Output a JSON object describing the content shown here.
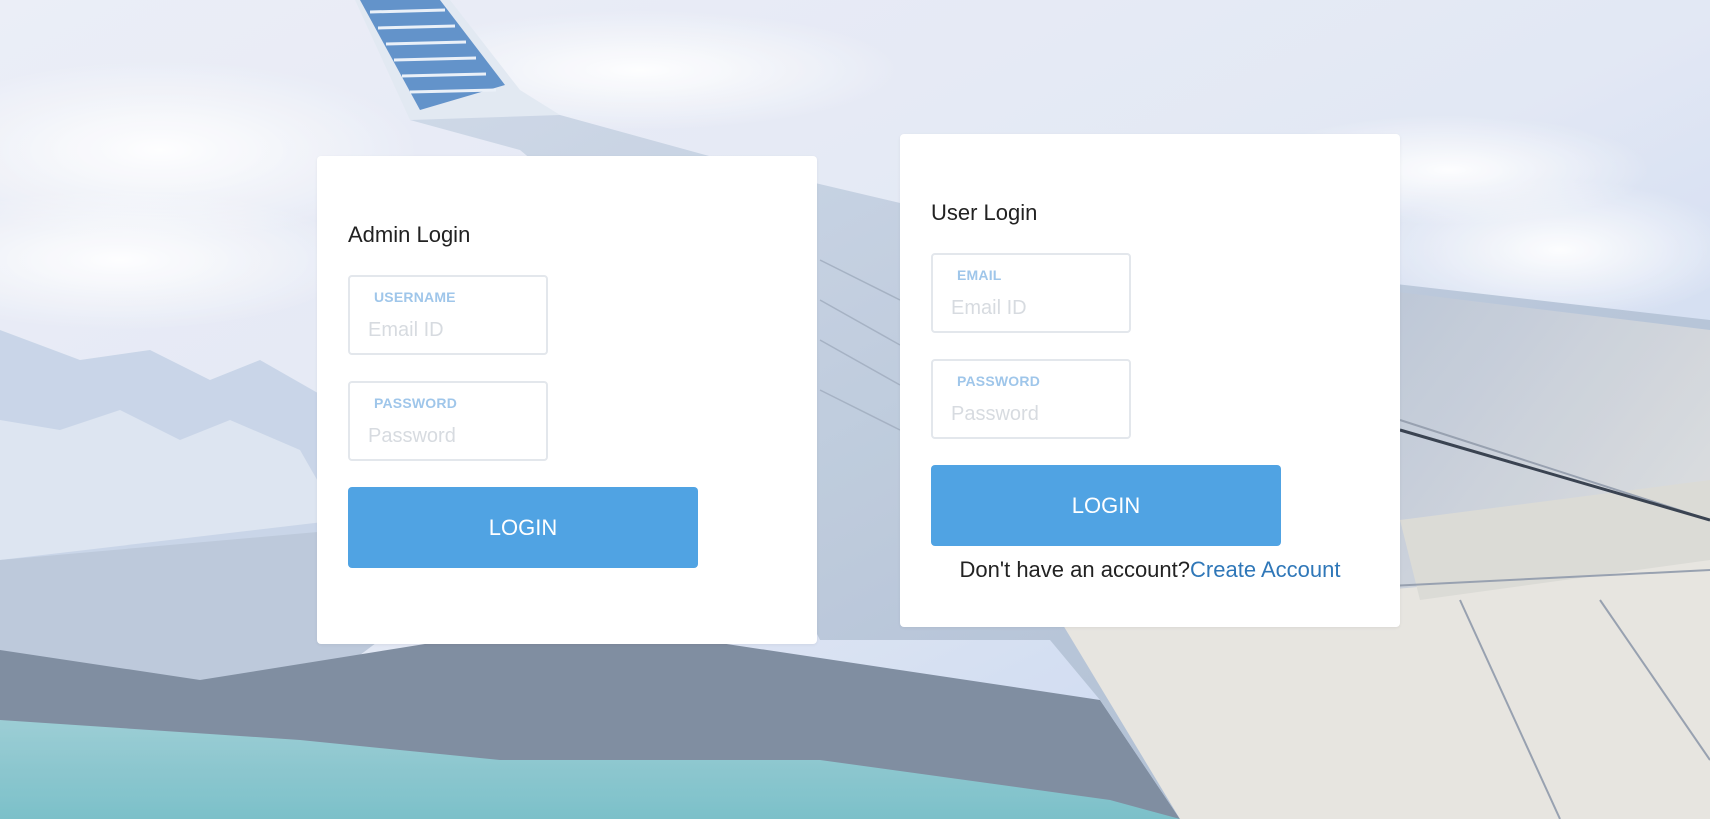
{
  "admin_login": {
    "title": "Admin Login",
    "username_label": "USERNAME",
    "username_placeholder": "Email ID",
    "password_label": "PASSWORD",
    "password_placeholder": "Password",
    "login_button": "LOGIN"
  },
  "user_login": {
    "title": "User Login",
    "email_label": "EMAIL",
    "email_placeholder": "Email ID",
    "password_label": "PASSWORD",
    "password_placeholder": "Password",
    "login_button": "LOGIN",
    "no_account_text": "Don't have an account?",
    "create_account_link": "Create Account"
  },
  "colors": {
    "accent": "#50a3e3",
    "field_label": "#9fc6ea",
    "link": "#2f77b8",
    "card_background": "#ffffff"
  }
}
